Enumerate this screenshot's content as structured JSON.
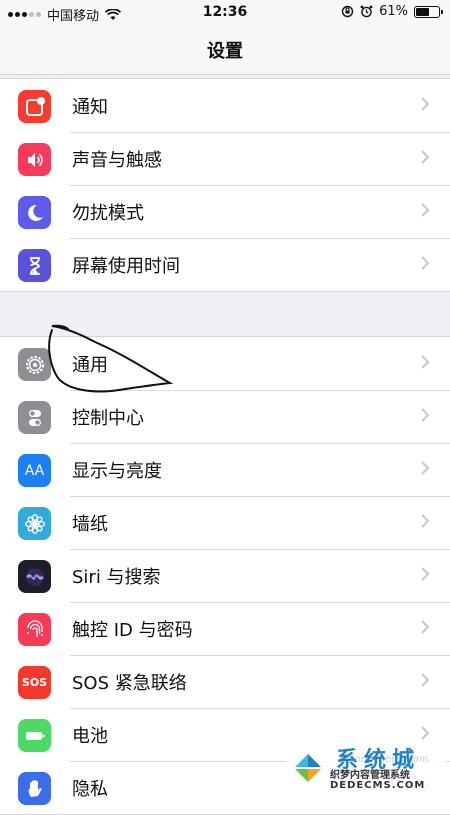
{
  "status_bar": {
    "carrier": "中国移动",
    "time": "12:36",
    "battery_percent": "61%",
    "battery_level": 0.61,
    "icons": [
      "signal-icon",
      "wifi-icon",
      "rotation-lock-icon",
      "alarm-icon",
      "battery-icon"
    ]
  },
  "nav": {
    "title": "设置"
  },
  "groups": [
    {
      "items": [
        {
          "label": "通知",
          "icon": "notification-icon",
          "color": "#fa3c30"
        },
        {
          "label": "声音与触感",
          "icon": "speaker-icon",
          "color": "#f93a5c"
        },
        {
          "label": "勿扰模式",
          "icon": "moon-icon",
          "color": "#5e5ce6"
        },
        {
          "label": "屏幕使用时间",
          "icon": "hourglass-icon",
          "color": "#5b53d6"
        }
      ]
    },
    {
      "items": [
        {
          "label": "通用",
          "icon": "gear-icon",
          "color": "#8e8e93"
        },
        {
          "label": "控制中心",
          "icon": "toggles-icon",
          "color": "#8e8e93"
        },
        {
          "label": "显示与亮度",
          "icon": "text-size-icon",
          "color": "#1d7ff2"
        },
        {
          "label": "墙纸",
          "icon": "flower-icon",
          "color": "#34aadc"
        },
        {
          "label": "Siri 与搜索",
          "icon": "siri-icon",
          "color": "#2a2a3a"
        },
        {
          "label": "触控 ID 与密码",
          "icon": "fingerprint-icon",
          "color": "#f73a56"
        },
        {
          "label": "SOS 紧急联络",
          "icon": "sos-icon",
          "color": "#f23a2c"
        },
        {
          "label": "电池",
          "icon": "battery-app-icon",
          "color": "#4cd964"
        },
        {
          "label": "隐私",
          "icon": "hand-icon",
          "color": "#3a6ee8"
        }
      ]
    }
  ],
  "icon_text": {
    "display": "AA",
    "sos": "SOS"
  },
  "watermark": {
    "title": "系统城",
    "subtitle": "织梦内容管理系统",
    "url": "DEDECMS.COM",
    "faint": "xitongcheng.com"
  }
}
